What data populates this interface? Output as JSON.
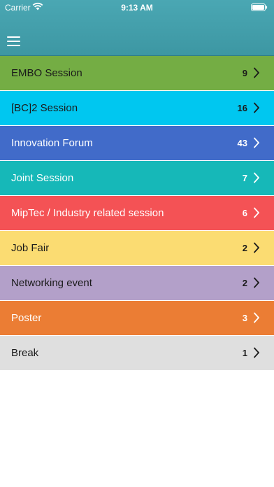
{
  "status_bar": {
    "carrier": "Carrier",
    "time": "9:13 AM"
  },
  "header": {
    "menu_icon": "hamburger-menu-icon"
  },
  "sessions": [
    {
      "label": "EMBO Session",
      "count": "9",
      "color": "#74ad44",
      "text_color": "#1a1a1a"
    },
    {
      "label": "[BC]2 Session",
      "count": "16",
      "color": "#00c7f0",
      "text_color": "#1a1a1a"
    },
    {
      "label": "Innovation Forum",
      "count": "43",
      "color": "#416bc9",
      "text_color": "#ffffff"
    },
    {
      "label": "Joint Session",
      "count": "7",
      "color": "#16b8b8",
      "text_color": "#ffffff"
    },
    {
      "label": "MipTec / Industry related session",
      "count": "6",
      "color": "#f45255",
      "text_color": "#ffffff"
    },
    {
      "label": "Job Fair",
      "count": "2",
      "color": "#fbdc72",
      "text_color": "#1a1a1a"
    },
    {
      "label": "Networking event",
      "count": "2",
      "color": "#b3a0c9",
      "text_color": "#1a1a1a"
    },
    {
      "label": "Poster",
      "count": "3",
      "color": "#eb7d34",
      "text_color": "#ffffff"
    },
    {
      "label": "Break",
      "count": "1",
      "color": "#dfdfdf",
      "text_color": "#1a1a1a"
    }
  ]
}
